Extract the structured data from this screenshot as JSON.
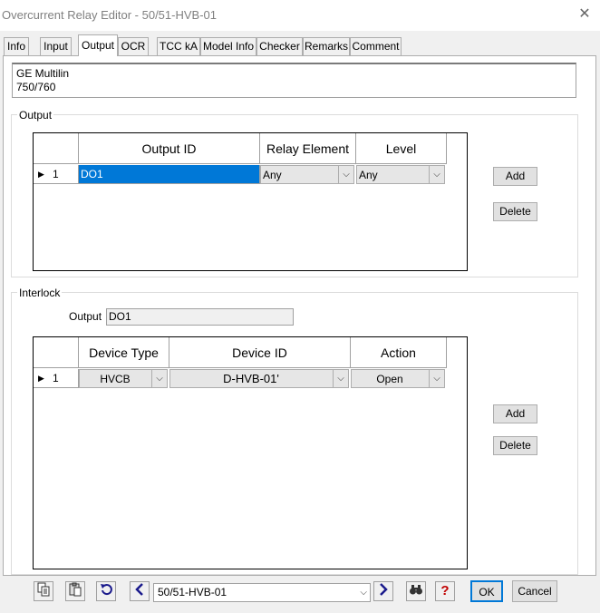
{
  "window": {
    "title": "Overcurrent Relay Editor - 50/51-HVB-01",
    "close_glyph": "✕"
  },
  "tabs": [
    {
      "label": "Info",
      "active": false
    },
    {
      "label": "Input",
      "active": false
    },
    {
      "label": "Output",
      "active": true
    },
    {
      "label": "OCR",
      "active": false
    },
    {
      "label": "TCC kA",
      "active": false
    },
    {
      "label": "Model Info",
      "active": false
    },
    {
      "label": "Checker",
      "active": false
    },
    {
      "label": "Remarks",
      "active": false
    },
    {
      "label": "Comment",
      "active": false
    }
  ],
  "relay": {
    "manufacturer": "GE Multilin",
    "model": "750/760"
  },
  "output_group": {
    "label": "Output",
    "columns": [
      "Output ID",
      "Relay Element",
      "Level"
    ],
    "rows": [
      {
        "num": "1",
        "output_id": "DO1",
        "relay_element": "Any",
        "level": "Any"
      }
    ],
    "add_label": "Add",
    "delete_label": "Delete"
  },
  "interlock_group": {
    "label": "Interlock",
    "output_label": "Output",
    "output_value": "DO1",
    "columns": [
      "Device Type",
      "Device ID",
      "Action"
    ],
    "rows": [
      {
        "num": "1",
        "device_type": "HVCB",
        "device_id": "D-HVB-01'",
        "action": "Open"
      }
    ],
    "add_label": "Add",
    "delete_label": "Delete"
  },
  "bottom": {
    "nav_value": "50/51-HVB-01",
    "ok_label": "OK",
    "cancel_label": "Cancel",
    "icons": [
      "copy-icon",
      "paste-icon",
      "undo-icon",
      "previous-icon",
      "next-icon",
      "find-icon",
      "help-icon"
    ]
  },
  "colors": {
    "selection": "#0078d7",
    "nav_arrow": "#1a1a8c",
    "help": "#c00000"
  }
}
